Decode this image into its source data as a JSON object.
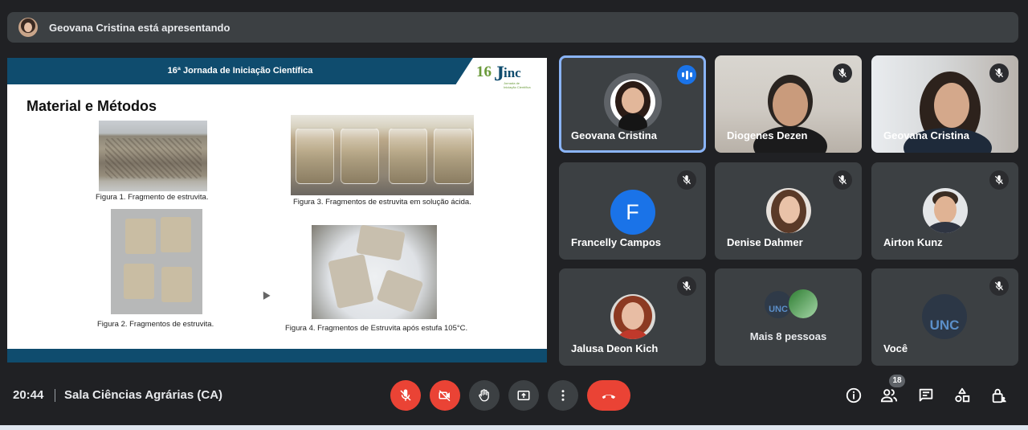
{
  "banner": {
    "text": "Geovana Cristina está apresentando"
  },
  "slide": {
    "header_title": "16ª Jornada de Iniciação Científica",
    "logo_number": "16",
    "logo_letter": "J",
    "logo_text": "inc",
    "logo_subtext": "Jornada de Iniciação Científica",
    "heading": "Material e Métodos",
    "figures": [
      {
        "caption": "Figura 1. Fragmento de estruvita."
      },
      {
        "caption": "Figura 3. Fragmentos de estruvita em solução ácida."
      },
      {
        "caption": "Figura 2. Fragmentos de estruvita."
      },
      {
        "caption": "Figura 4. Fragmentos de Estruvita após estufa 105°C."
      }
    ]
  },
  "participants": [
    {
      "name": "Geovana Cristina",
      "state": "speaking"
    },
    {
      "name": "Diogenes Dezen",
      "state": "muted"
    },
    {
      "name": "Geovana Cristina",
      "state": "muted"
    },
    {
      "name": "Francelly Campos",
      "state": "muted",
      "initial": "F"
    },
    {
      "name": "Denise Dahmer",
      "state": "muted"
    },
    {
      "name": "Airton Kunz",
      "state": "muted"
    },
    {
      "name": "Jalusa Deon Kich",
      "state": "muted"
    },
    {
      "name": "Mais 8 pessoas"
    },
    {
      "name": "Você",
      "state": "muted"
    }
  ],
  "bottom_bar": {
    "time": "20:44",
    "room": "Sala Ciências Agrárias (CA)",
    "people_count": "18"
  },
  "colors": {
    "accent": "#1a73e8",
    "danger": "#ea4335",
    "slide_header": "#0f4c6e",
    "background": "#202124"
  }
}
